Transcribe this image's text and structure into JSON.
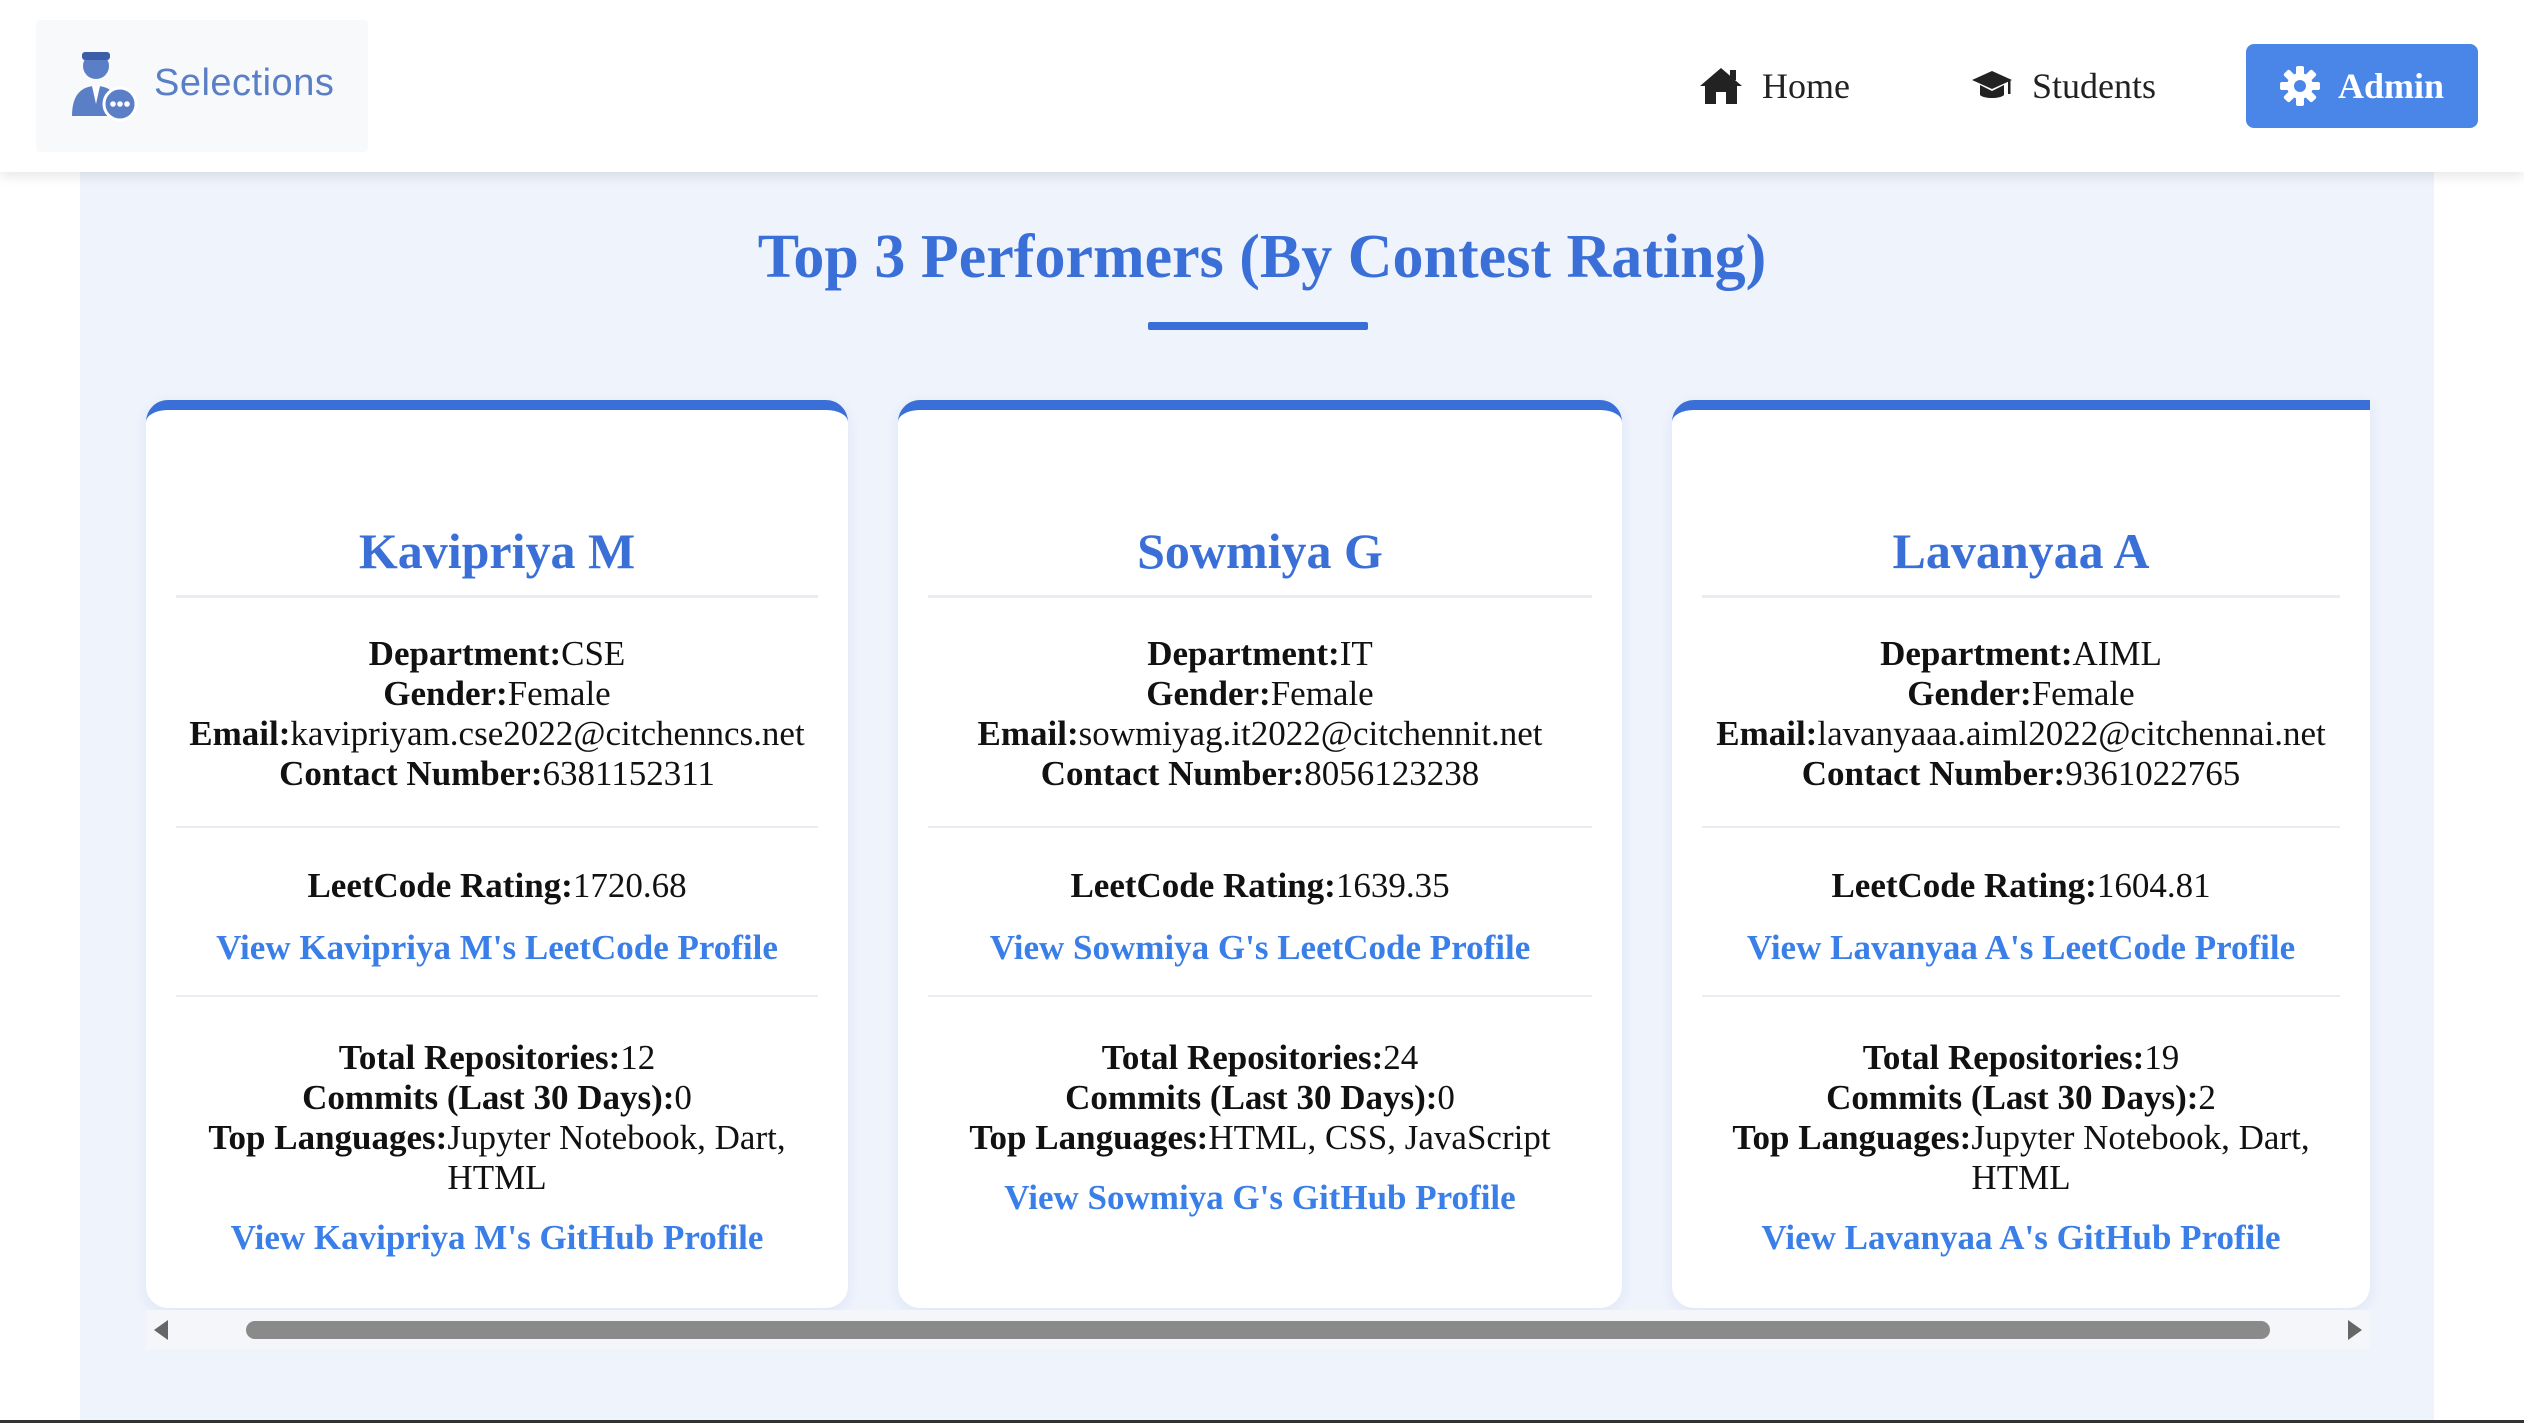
{
  "header": {
    "brand": {
      "icon": "recruiter-chat-icon",
      "label": "Selections"
    },
    "nav": [
      {
        "icon": "home-icon",
        "label": "Home"
      },
      {
        "icon": "graduation-cap-icon",
        "label": "Students"
      }
    ],
    "admin": {
      "icon": "gear-icon",
      "label": "Admin"
    }
  },
  "main": {
    "title": "Top 3 Performers (By Contest Rating)",
    "labels": {
      "department": "Department:",
      "gender": "Gender:",
      "email": "Email:",
      "contact": "Contact Number:",
      "leetcode_rating": "LeetCode Rating:",
      "total_repos": "Total Repositories:",
      "commits": "Commits (Last 30 Days):",
      "top_languages": "Top Languages:"
    },
    "cards": [
      {
        "name": "Kavipriya M",
        "department": "CSE",
        "gender": "Female",
        "email": "kavipriyam.cse2022@citchenncs.net",
        "contact": "6381152311",
        "leetcode_rating": "1720.68",
        "leetcode_link": "View Kavipriya M's LeetCode Profile",
        "total_repos": "12",
        "commits": "0",
        "top_languages": "Jupyter Notebook, Dart, HTML",
        "github_link": "View Kavipriya M's GitHub Profile"
      },
      {
        "name": "Sowmiya G",
        "department": "IT",
        "gender": "Female",
        "email": "sowmiyag.it2022@citchennit.net",
        "contact": "8056123238",
        "leetcode_rating": "1639.35",
        "leetcode_link": "View Sowmiya G's LeetCode Profile",
        "total_repos": "24",
        "commits": "0",
        "top_languages": "HTML, CSS, JavaScript",
        "github_link": "View Sowmiya G's GitHub Profile"
      },
      {
        "name": "Lavanyaa A",
        "department": "AIML",
        "gender": "Female",
        "email": "lavanyaaa.aiml2022@citchennai.net",
        "contact": "9361022765",
        "leetcode_rating": "1604.81",
        "leetcode_link": "View Lavanyaa A's LeetCode Profile",
        "total_repos": "19",
        "commits": "2",
        "top_languages": "Jupyter Notebook, Dart, HTML",
        "github_link": "View Lavanyaa A's GitHub Profile"
      }
    ],
    "scrollbar": {
      "position_fraction": 0.0,
      "visible_fraction": 0.91
    }
  },
  "colors": {
    "accent": "#3a6fd8",
    "link": "#3a7ee8",
    "admin_bg": "#4a86e8",
    "panel_bg": "#eef3fc"
  }
}
